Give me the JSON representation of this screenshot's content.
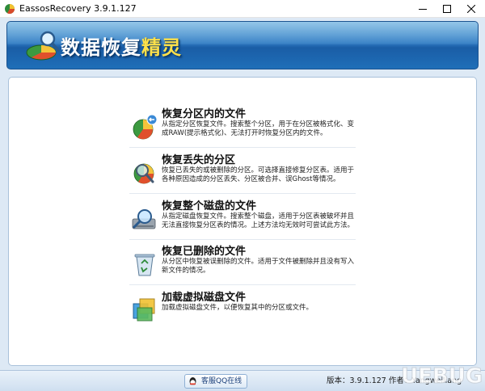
{
  "window": {
    "title": "EassosRecovery 3.9.1.127",
    "controls": {
      "minimize": "─",
      "maximize": "☐",
      "close": "✕"
    }
  },
  "banner": {
    "title_main": "数据恢复",
    "title_accent": "精灵",
    "colors": {
      "top": "#5aa7dc",
      "bottom": "#1f6fb8",
      "accent_text": "#ffe14a"
    }
  },
  "options": [
    {
      "title": "恢复分区内的文件",
      "description": "从指定分区恢复文件。搜索整个分区，用于在分区被格式化、变成RAW(提示格式化)、无法打开时恢复分区内的文件。",
      "icon": "partition-pie-icon"
    },
    {
      "title": "恢复丢失的分区",
      "description": "恢复已丢失的或被删除的分区。可选择直接修复分区表。适用于各种原因造成的分区丢失、分区被合并、误Ghost等情况。",
      "icon": "magnifier-pie-icon"
    },
    {
      "title": "恢复整个磁盘的文件",
      "description": "从指定磁盘恢复文件。搜索整个磁盘，适用于分区表被破坏并且无法直接恢复分区表的情况。上述方法均无效时可尝试此方法。",
      "icon": "disk-magnifier-icon"
    },
    {
      "title": "恢复已删除的文件",
      "description": "从分区中恢复被误删除的文件。适用于文件被删除并且没有写入新文件的情况。",
      "icon": "recycle-bin-icon"
    },
    {
      "title": "加载虚拟磁盘文件",
      "description": "加载虚拟磁盘文件，以便恢复其中的分区或文件。",
      "icon": "virtual-disk-icon"
    }
  ],
  "statusbar": {
    "qq_label": "客服QQ在线",
    "version_text": "版本：3.9.1.127 作者：Yangweiliang"
  },
  "watermark": {
    "text": "UEBUG"
  }
}
